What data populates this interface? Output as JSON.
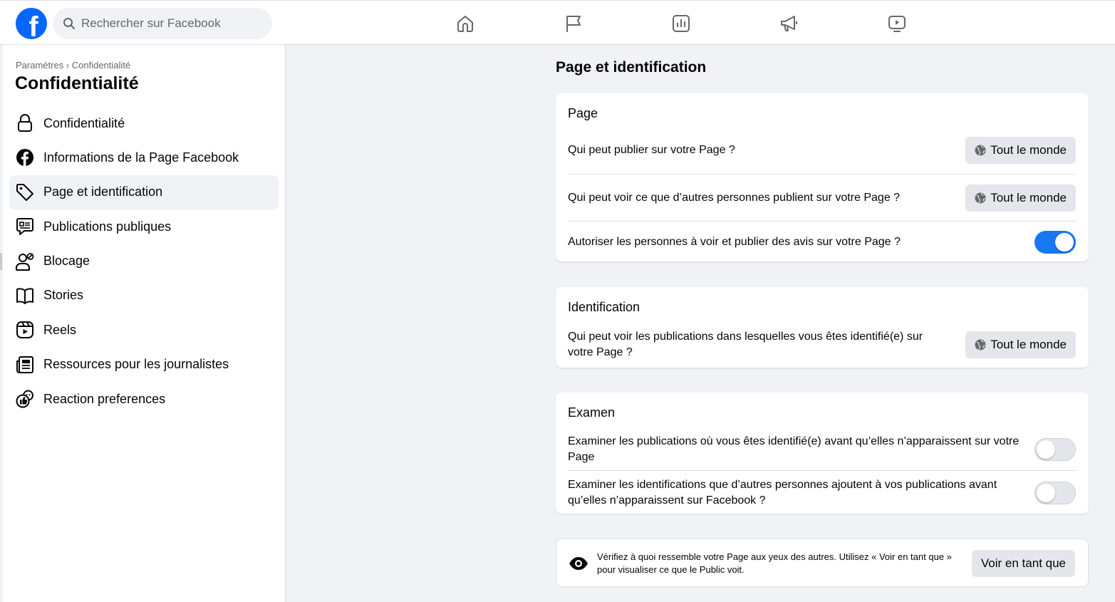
{
  "search": {
    "placeholder": "Rechercher sur Facebook"
  },
  "topnav": [
    "home-icon",
    "flag-icon",
    "insights-icon",
    "megaphone-icon",
    "video-icon"
  ],
  "colors": {
    "brand": "#0866ff",
    "toggle_on": "#1877f2",
    "button_bg": "#e4e6eb",
    "page_bg": "#f0f2f5"
  },
  "sidebar": {
    "breadcrumb": "Paramètres › Confidentialité",
    "title": "Confidentialité",
    "items": [
      {
        "label": "Confidentialité",
        "icon": "lock-icon"
      },
      {
        "label": "Informations de la Page Facebook",
        "icon": "facebook-icon"
      },
      {
        "label": "Page et identification",
        "icon": "tag-icon",
        "active": true
      },
      {
        "label": "Publications publiques",
        "icon": "public-posts-icon"
      },
      {
        "label": "Blocage",
        "icon": "block-user-icon"
      },
      {
        "label": "Stories",
        "icon": "book-icon"
      },
      {
        "label": "Reels",
        "icon": "reels-icon"
      },
      {
        "label": "Ressources pour les journalistes",
        "icon": "newspaper-icon"
      },
      {
        "label": "Reaction preferences",
        "icon": "reaction-icon"
      }
    ]
  },
  "main": {
    "title": "Page et identification",
    "page_card": {
      "title": "Page",
      "rows": [
        {
          "question": "Qui peut publier sur votre Page ?",
          "value": "Tout le monde"
        },
        {
          "question": "Qui peut voir ce que d’autres personnes publient sur votre Page ?",
          "value": "Tout le monde"
        },
        {
          "question": "Autoriser les personnes à voir et publier des avis sur votre Page ?",
          "toggle": true
        }
      ]
    },
    "tag_card": {
      "title": "Identification",
      "rows": [
        {
          "question": "Qui peut voir les publications dans lesquelles vous êtes identifié(e) sur votre Page ?",
          "value": "Tout le monde"
        }
      ]
    },
    "review_card": {
      "title": "Examen",
      "rows": [
        {
          "question": "Examiner les publications où vous êtes identifié(e) avant qu’elles n’apparaissent sur votre Page",
          "toggle": false
        },
        {
          "question": "Examiner les identifications que d’autres personnes ajoutent à vos publications avant qu’elles n’apparaissent sur Facebook ?",
          "toggle": false
        }
      ]
    },
    "view_as": {
      "text": "Vérifiez à quoi ressemble votre Page aux yeux des autres. Utilisez « Voir en tant que » pour visualiser ce que le Public voit.",
      "button": "Voir en tant que"
    }
  }
}
